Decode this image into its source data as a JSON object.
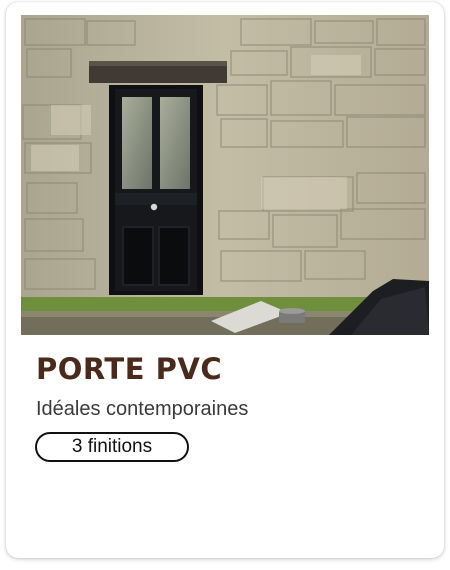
{
  "product_card": {
    "image_alt": "Porte PVC noire dans un mur en pierre",
    "title": "PORTE PVC",
    "subtitle": "Idéales contemporaines",
    "finishes_badge": "3 finitions"
  },
  "colors": {
    "title": "#4a2a1a",
    "door": "#16181b",
    "stone": "#b7b09c"
  }
}
